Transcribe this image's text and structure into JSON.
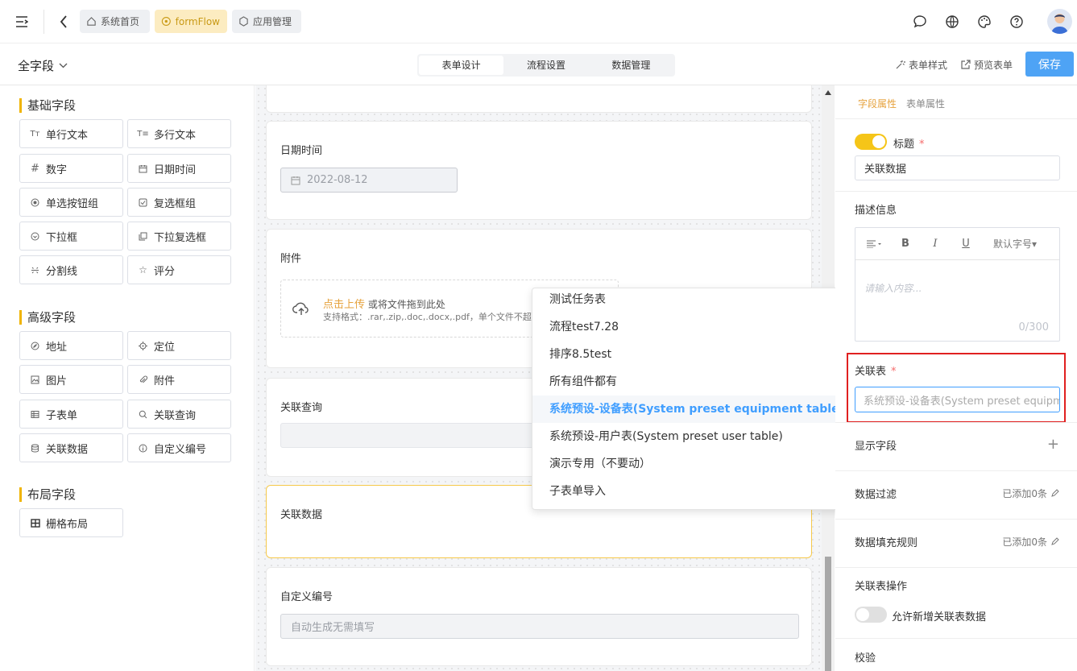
{
  "topbar": {
    "tabs": [
      {
        "label": "系统首页",
        "icon": "home-icon"
      },
      {
        "label": "formFlow",
        "icon": "flower-icon"
      },
      {
        "label": "应用管理",
        "icon": "apps-icon"
      }
    ],
    "icons": [
      "chat-icon",
      "globe-icon",
      "palette-icon",
      "help-icon"
    ]
  },
  "subbar": {
    "field_select": "全字段",
    "segments": [
      "表单设计",
      "流程设置",
      "数据管理"
    ],
    "active_segment": "表单设计",
    "form_style": "表单样式",
    "preview": "预览表单",
    "save": "保存"
  },
  "left": {
    "groups": [
      {
        "title": "基础字段",
        "items": [
          "单行文本",
          "多行文本",
          "数字",
          "日期时间",
          "单选按钮组",
          "复选框组",
          "下拉框",
          "下拉复选框",
          "分割线",
          "评分"
        ]
      },
      {
        "title": "高级字段",
        "items": [
          "地址",
          "定位",
          "图片",
          "附件",
          "子表单",
          "关联查询",
          "关联数据",
          "自定义编号"
        ]
      },
      {
        "title": "布局字段",
        "items": [
          "栅格布局"
        ]
      }
    ]
  },
  "canvas": {
    "date_label": "日期时间",
    "date_value": "2022-08-12",
    "attach_label": "附件",
    "upload_click": "点击上传",
    "upload_drag": "或将文件拖到此处",
    "upload_hint": "支持格式：.rar,.zip,.doc,.docx,.pdf，单个文件不超",
    "query_label": "关联查询",
    "reldata_label": "关联数据",
    "code_label": "自定义编号",
    "code_placeholder": "自动生成无需填写"
  },
  "dropdown": {
    "items": [
      "测试任务表",
      "流程test7.28",
      "排序8.5test",
      "所有组件都有",
      "系统预设-设备表(System preset equipment table)",
      "系统预设-用户表(System preset user table)",
      "演示专用（不要动）",
      "子表单导入"
    ],
    "highlighted": "系统预设-设备表(System preset equipment table)"
  },
  "right": {
    "tab_field": "字段属性",
    "tab_form": "表单属性",
    "title_label": "标题",
    "title_value": "关联数据",
    "desc_label": "描述信息",
    "font_size": "默认字号",
    "editor_placeholder": "请输入内容...",
    "editor_count": "0/300",
    "rel_table_label": "关联表",
    "rel_table_value": "系统预设-设备表(System preset equipment table)",
    "show_fields": "显示字段",
    "data_filter": "数据过滤",
    "data_filter_meta": "已添加0条",
    "fill_rule": "数据填充规则",
    "fill_rule_meta": "已添加0条",
    "rel_ops": "关联表操作",
    "allow_add": "允许新增关联表数据",
    "validate": "校验"
  },
  "colors": {
    "accent": "#f5c518",
    "primary": "#4ea3f5",
    "link": "#409eff",
    "highlight_border": "#e02020"
  }
}
